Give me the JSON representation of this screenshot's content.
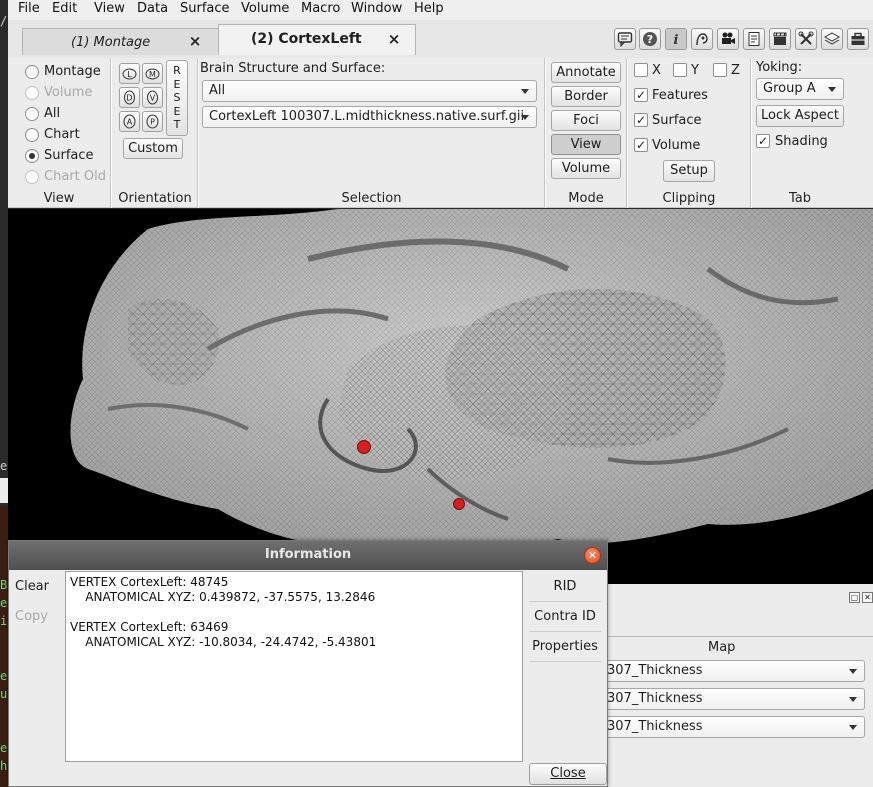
{
  "menubar": {
    "items": [
      "File",
      "Edit",
      "View",
      "Data",
      "Surface",
      "Volume",
      "Macro",
      "Window",
      "Help"
    ]
  },
  "tabs": [
    {
      "label": "(1) Montage",
      "active": false
    },
    {
      "label": "(2) CortexLeft",
      "active": true
    }
  ],
  "toolbar_icons": [
    "chat-icon",
    "help-icon",
    "info-icon",
    "identify-icon",
    "movie-icon",
    "scene-icon",
    "clapper-icon",
    "tools-icon",
    "layers-icon",
    "toolbox-icon"
  ],
  "view_group": {
    "title": "View",
    "options": [
      {
        "label": "Montage",
        "selected": false,
        "enabled": true
      },
      {
        "label": "Volume",
        "selected": false,
        "enabled": false
      },
      {
        "label": "All",
        "selected": false,
        "enabled": true
      },
      {
        "label": "Chart",
        "selected": false,
        "enabled": true
      },
      {
        "label": "Surface",
        "selected": true,
        "enabled": true
      },
      {
        "label": "Chart Old",
        "selected": false,
        "enabled": false
      }
    ]
  },
  "orientation_group": {
    "title": "Orientation",
    "buttons": [
      "L",
      "M",
      "D",
      "V",
      "A",
      "P"
    ],
    "reset_letters": [
      "R",
      "E",
      "S",
      "E",
      "T"
    ],
    "custom_label": "Custom"
  },
  "selection_group": {
    "title": "Selection",
    "label": "Brain Structure and Surface:",
    "structure": "All",
    "surface": "CortexLeft 100307.L.midthickness.native.surf.gii"
  },
  "mode_group": {
    "title": "Mode",
    "buttons": [
      {
        "label": "Annotate",
        "active": false
      },
      {
        "label": "Border",
        "active": false
      },
      {
        "label": "Foci",
        "active": false
      },
      {
        "label": "View",
        "active": true
      },
      {
        "label": "Volume",
        "active": false
      }
    ]
  },
  "clipping_group": {
    "title": "Clipping",
    "axes": [
      {
        "label": "X",
        "checked": false
      },
      {
        "label": "Y",
        "checked": false
      },
      {
        "label": "Z",
        "checked": false
      }
    ],
    "options": [
      {
        "label": "Features",
        "checked": true
      },
      {
        "label": "Surface",
        "checked": true
      },
      {
        "label": "Volume",
        "checked": true
      }
    ],
    "setup_label": "Setup"
  },
  "tab_group": {
    "title": "Tab",
    "yoking_label": "Yoking:",
    "yoking_value": "Group A",
    "lock_aspect_label": "Lock Aspect",
    "shading_label": "Shading",
    "shading_checked": true
  },
  "check_mark": "✓",
  "layers_panel": {
    "map_header": "Map",
    "maps": [
      "307_Thickness",
      "307_Thickness",
      "307_Thickness"
    ]
  },
  "terminal_glyphs": {
    "slash": "/",
    "ea": "ea",
    "B": "B",
    "e": "e",
    "i": "i",
    "u": "u",
    "h": "h"
  },
  "dialog": {
    "title": "Information",
    "clear_label": "Clear",
    "copy_label": "Copy",
    "text": "VERTEX CortexLeft: 48745\n    ANATOMICAL XYZ: 0.439872, -37.5575, 13.2846\n\nVERTEX CortexLeft: 63469\n    ANATOMICAL XYZ: -10.8034, -24.4742, -5.43801",
    "right_buttons": [
      "RID",
      "Contra ID",
      "Properties"
    ],
    "close_label": "Close"
  },
  "colors": {
    "focus_marker": "#d42020",
    "viewport_background": "#000000"
  }
}
